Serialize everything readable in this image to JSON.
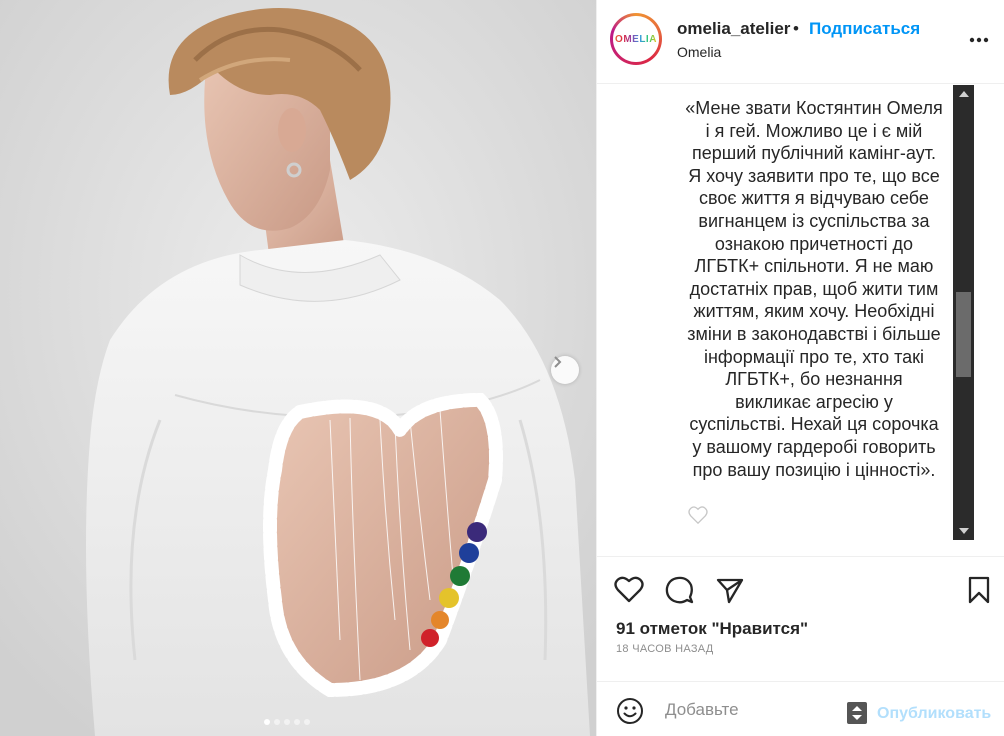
{
  "post": {
    "username": "omelia_atelier",
    "bullet": "•",
    "follow_label": "Подписаться",
    "location": "Omelia",
    "avatar_text": "OMELIA",
    "caption": "«Мене звати Костянтин Омеля\nі я гей. Можливо це і є мій\nперший публічний камінг-аут.\nЯ хочу заявити про те, що все\nсвоє життя я відчуваю себе\nвигнанцем із суспільства за\nознакою причетності до\nЛГБТК+ спільноти. Я не маю\nдостатніх прав, щоб жити тим\nжиттям, яким хочу. Необхідні\nзміни в законодавстві і більше\nінформації про те, хто такі\nЛГБТК+, бо незнання\nвикликає агресію у\nсуспільстві. Нехай ця сорочка\nу вашому гардеробі говорить\nпро вашу позицію і цінності».",
    "likes": "91 отметок \"Нравится\"",
    "time_ago": "18 ЧАСОВ НАЗАД"
  },
  "comment": {
    "placeholder": "Добавьте",
    "publish_label": "Опубликовать"
  },
  "carousel": {
    "total_slides": 5,
    "active_slide": 1
  },
  "icons": {
    "more": "more-dots-icon",
    "like": "heart-icon",
    "comment": "comment-bubble-icon",
    "share": "paper-plane-icon",
    "save": "bookmark-icon",
    "emoji": "smiley-icon",
    "next": "chevron-right-icon"
  },
  "colors": {
    "accent": "#0095f6",
    "publish_disabled": "#b2dffc",
    "muted": "#8e8e8e",
    "scrollbar_bg": "#2b2b2b"
  }
}
